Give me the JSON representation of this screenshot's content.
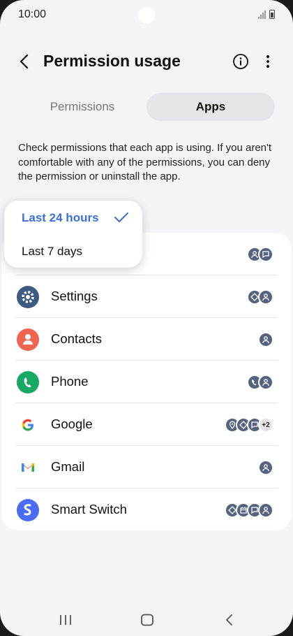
{
  "status_bar": {
    "time": "10:00"
  },
  "appbar": {
    "title": "Permission usage"
  },
  "tabs": [
    {
      "label": "Permissions",
      "selected": false
    },
    {
      "label": "Apps",
      "selected": true
    }
  ],
  "description": "Check permissions that each app is using. If you aren't comfortable with any of the permissions, you can deny the permission or uninstall the app.",
  "time_filter": {
    "options": [
      "Last 24 hours",
      "Last 7 days"
    ],
    "selected": "Last 24 hours"
  },
  "apps": [
    {
      "name": "",
      "icon": "app-icon",
      "badges": [
        "person-icon",
        "chat-icon"
      ]
    },
    {
      "name": "Settings",
      "icon": "settings-gear-icon",
      "badges": [
        "location-diamond-icon",
        "person-icon"
      ]
    },
    {
      "name": "Contacts",
      "icon": "contacts-icon",
      "badges": [
        "person-icon"
      ]
    },
    {
      "name": "Phone",
      "icon": "phone-icon",
      "badges": [
        "call-log-icon",
        "person-icon"
      ]
    },
    {
      "name": "Google",
      "icon": "google-icon",
      "badges": [
        "location-icon",
        "nearby-devices-icon",
        "chat-icon"
      ],
      "extra": "+2"
    },
    {
      "name": "Gmail",
      "icon": "gmail-icon",
      "badges": [
        "person-icon"
      ]
    },
    {
      "name": "Smart Switch",
      "icon": "smart-switch-icon",
      "badges": [
        "nearby-devices-icon",
        "calendar-icon",
        "chat-icon",
        "person-icon"
      ]
    }
  ],
  "colors": {
    "accent": "#3a6fd8",
    "badge": "#56637f",
    "background": "#f4f4f7"
  }
}
